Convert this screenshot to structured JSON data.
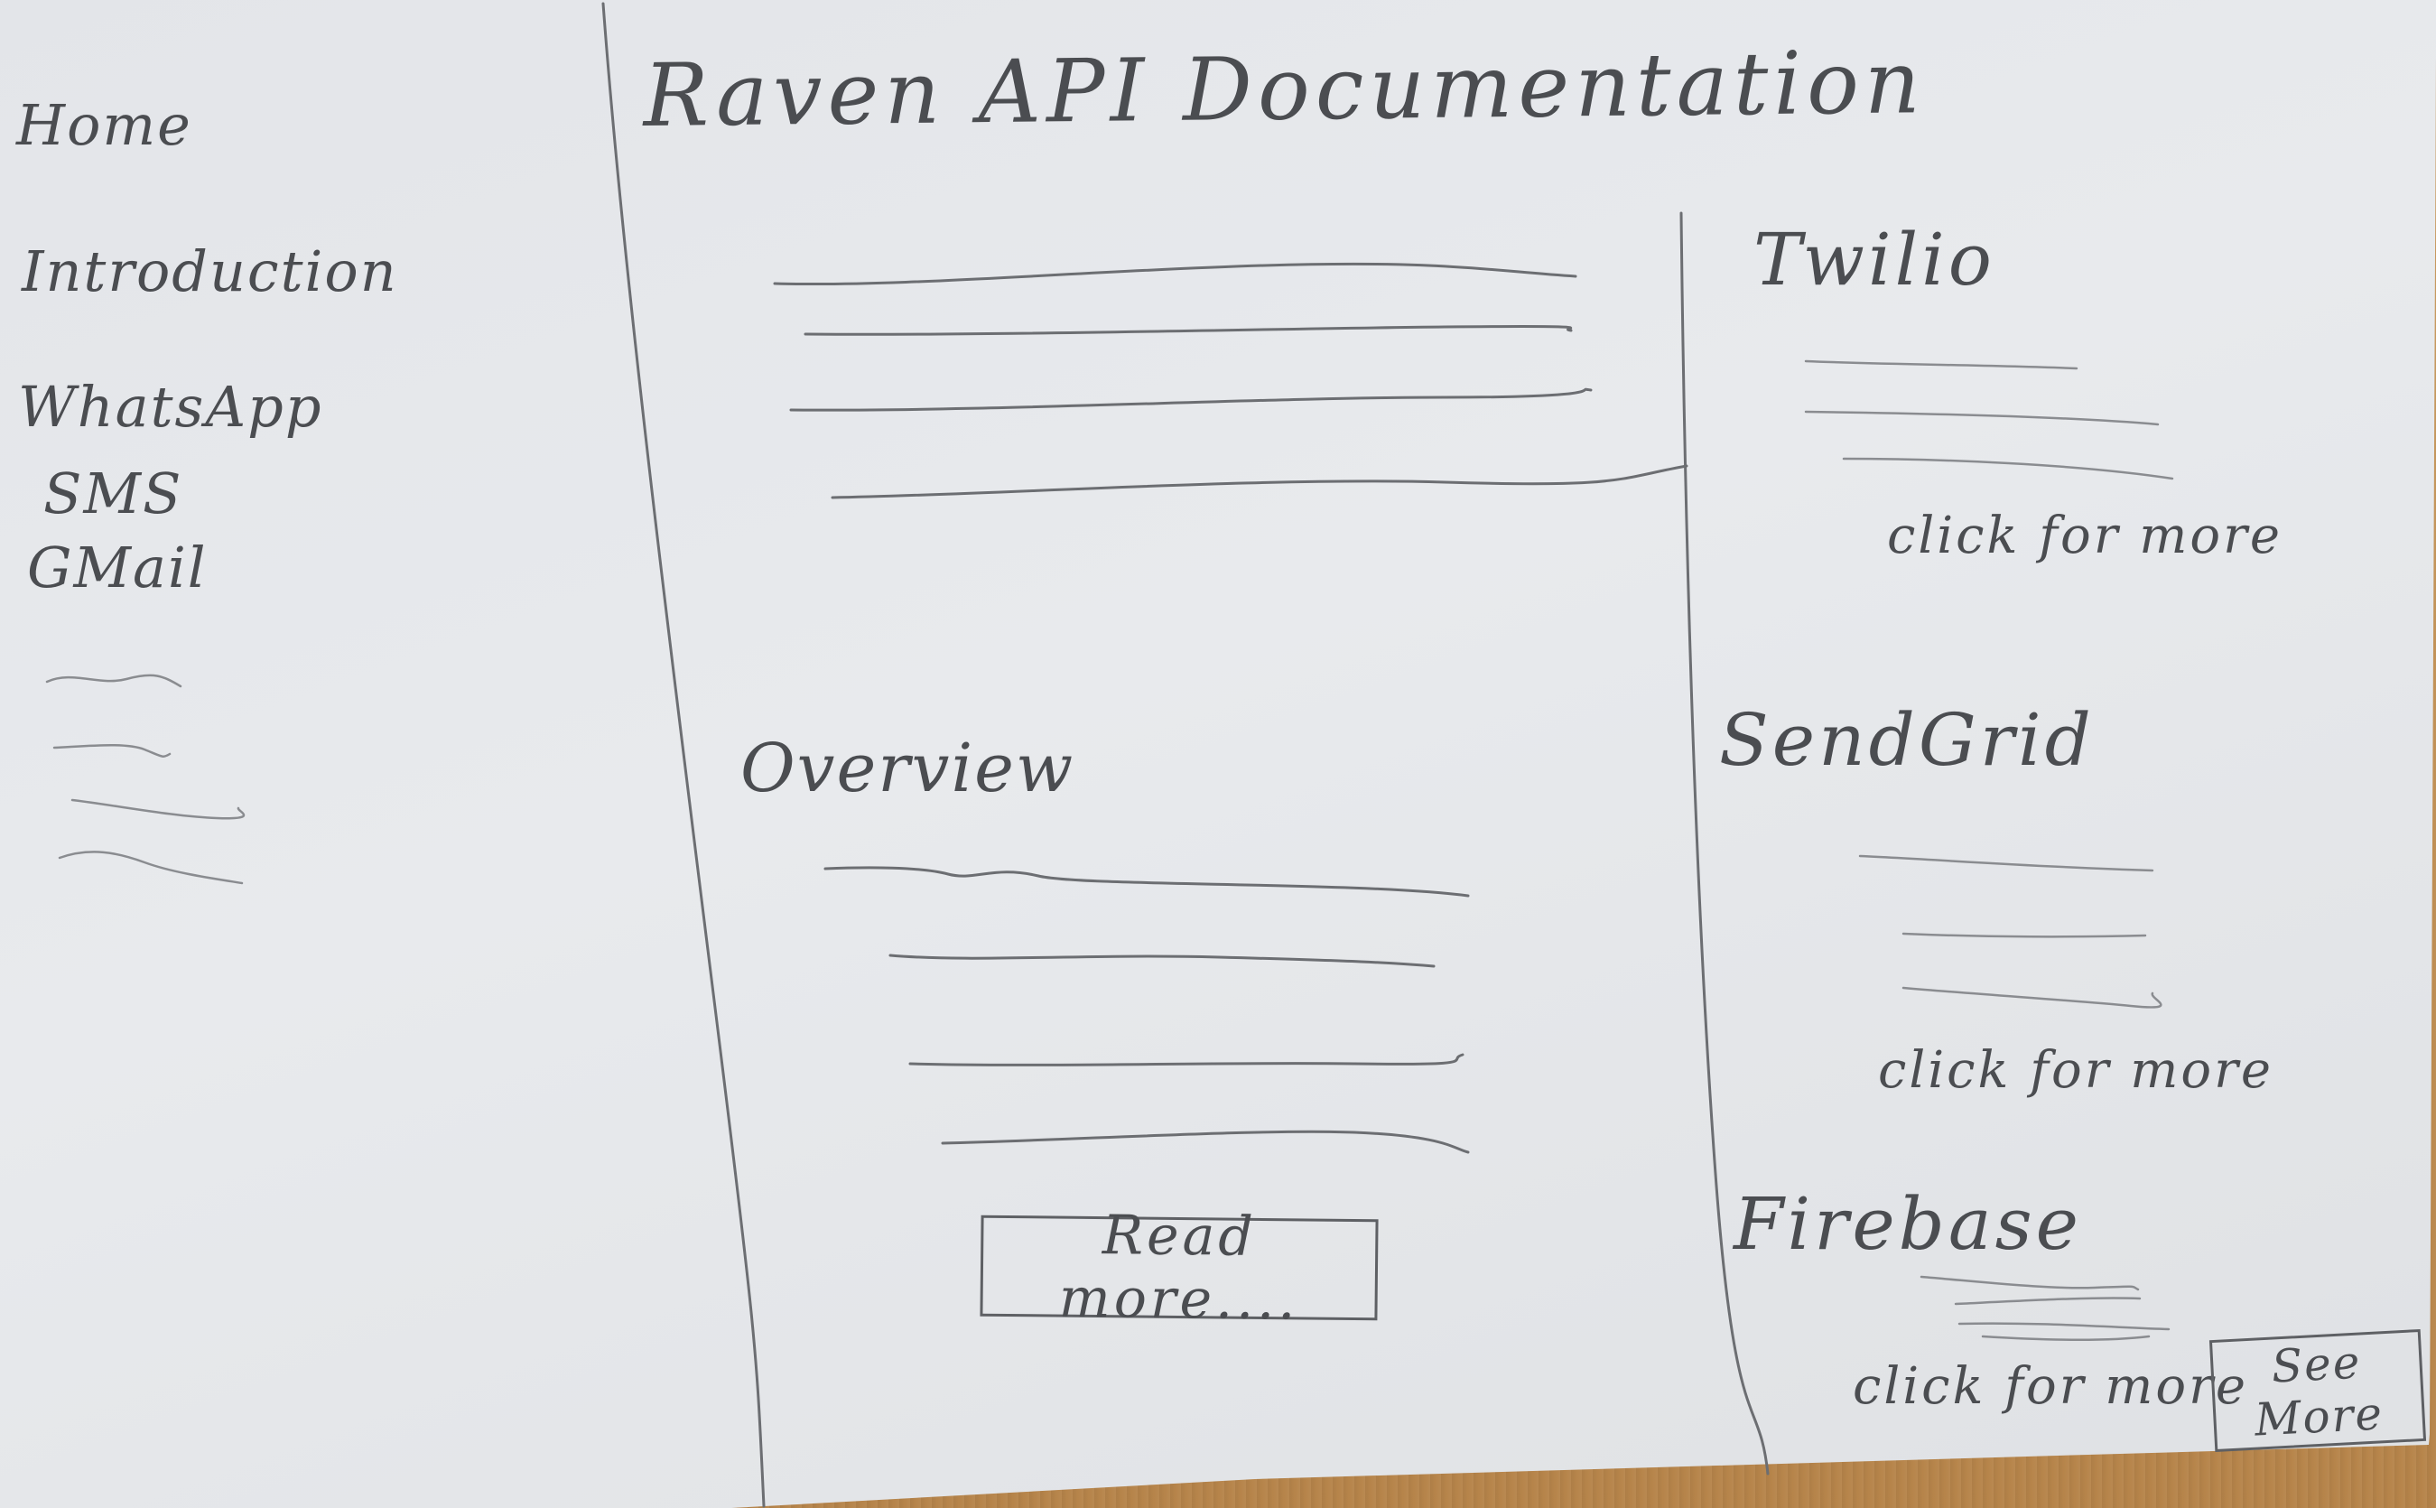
{
  "sidebar": {
    "items": [
      {
        "label": "Home"
      },
      {
        "label": "Introduction"
      },
      {
        "label": "WhatsApp"
      },
      {
        "label": "SMS"
      },
      {
        "label": "GMail"
      }
    ]
  },
  "main": {
    "title": "Raven API Documentation",
    "overview": {
      "heading": "Overview",
      "read_more_label": "Read more...."
    }
  },
  "right_panel": {
    "cards": [
      {
        "title": "Twilio",
        "link": "click for more"
      },
      {
        "title": "SendGrid",
        "link": "click for more"
      },
      {
        "title": "Firebase",
        "link": "click for more"
      }
    ],
    "see_more_label": "See More"
  }
}
